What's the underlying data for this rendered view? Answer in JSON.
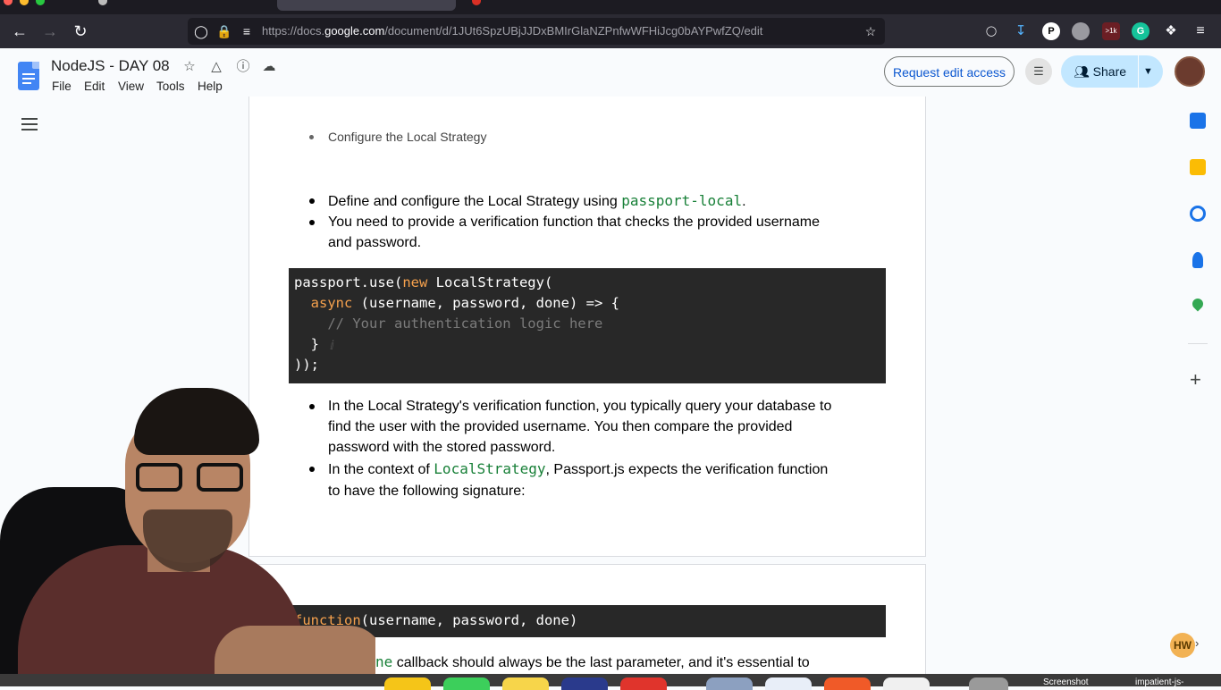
{
  "browser": {
    "url_prefix": "https://docs.",
    "url_domain": "google.com",
    "url_path": "/document/d/1JUt6SpzUBjJJDxBMIrGlaNZPnfwWFHiJcg0bAYPwfZQ/edit",
    "extension_badge": ">1k"
  },
  "docs": {
    "title": "NodeJS - DAY 08",
    "menu": [
      "File",
      "Edit",
      "View",
      "Tools",
      "Help"
    ],
    "request_edit_label": "Request edit access",
    "share_label": "Share"
  },
  "content": {
    "bullet_1": "Configure the Local Strategy",
    "bullet_2_text": "Define and configure the Local Strategy using ",
    "bullet_2_code": "passport-local",
    "bullet_2_end": ".",
    "bullet_3_line1": "You need to provide a verification function that checks the provided username",
    "bullet_3_line2": "and password.",
    "code_block_1": {
      "line1_a": "passport.use(",
      "line1_kw": "new",
      "line1_b": " LocalStrategy(",
      "line2_kw": "  async",
      "line2_b": " (username, password, done) => {",
      "line3": "    // Your authentication logic here",
      "line4": "  }",
      "line5": "));"
    },
    "bullet_4_line1": "In the Local Strategy's verification function, you typically query your database to",
    "bullet_4_line2": "find the user with the provided username. You then compare the provided",
    "bullet_4_line3": "password with the stored password.",
    "bullet_5_text": "In the context of ",
    "bullet_5_code": "LocalStrategy",
    "bullet_5_end": ", Passport.js expects the verification function",
    "bullet_5_line2": "to have the following signature:",
    "code_block_2": {
      "kw": "function",
      "rest": "(username, password, done)"
    },
    "trailing_text_code": "ne",
    "trailing_text": " callback should always be the last parameter, and it's essential to"
  },
  "dock": {
    "label_1": "Screenshot",
    "label_2": "impatient-js-"
  },
  "overlay": {
    "badge": "HW"
  }
}
